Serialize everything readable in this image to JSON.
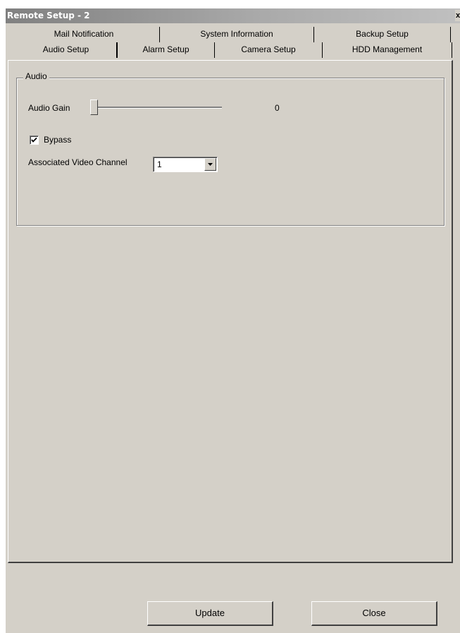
{
  "window": {
    "title": "Remote Setup - 2",
    "close_glyph": "x"
  },
  "tabs": {
    "back_row": [
      "Mail Notification",
      "System Information",
      "Backup Setup"
    ],
    "front_row": [
      "Audio Setup",
      "Alarm Setup",
      "Camera Setup",
      "HDD Management"
    ],
    "active": "Audio Setup"
  },
  "audio_group": {
    "legend": "Audio",
    "gain_label": "Audio Gain",
    "gain_value": "0",
    "gain_level": 0,
    "bypass_label": "Bypass",
    "bypass_checked": true,
    "video_channel_label": "Associated Video Channel",
    "video_channel_value": "1"
  },
  "buttons": {
    "update": "Update",
    "close": "Close"
  },
  "icons": {
    "checkbox_mark": "check-icon",
    "dropdown": "chevron-down-icon"
  }
}
